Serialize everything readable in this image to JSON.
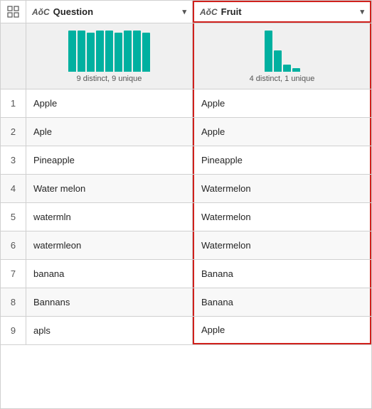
{
  "columns": {
    "question": {
      "label": "Question",
      "type_icon": "A B C",
      "stats": "9 distinct, 9 unique",
      "bars": [
        58,
        58,
        55,
        58,
        58,
        55,
        58,
        58,
        55
      ]
    },
    "fruit": {
      "label": "Fruit",
      "type_icon": "A B C",
      "stats": "4 distinct, 1 unique",
      "bars": [
        58,
        30,
        10,
        5
      ]
    }
  },
  "rows": [
    {
      "num": "1",
      "question": "Apple",
      "fruit": "Apple"
    },
    {
      "num": "2",
      "question": "Aple",
      "fruit": "Apple"
    },
    {
      "num": "3",
      "question": "Pineapple",
      "fruit": "Pineapple"
    },
    {
      "num": "4",
      "question": "Water melon",
      "fruit": "Watermelon"
    },
    {
      "num": "5",
      "question": "watermln",
      "fruit": "Watermelon"
    },
    {
      "num": "6",
      "question": "watermleon",
      "fruit": "Watermelon"
    },
    {
      "num": "7",
      "question": "banana",
      "fruit": "Banana"
    },
    {
      "num": "8",
      "question": "Bannans",
      "fruit": "Banana"
    },
    {
      "num": "9",
      "question": "apls",
      "fruit": "Apple"
    }
  ]
}
